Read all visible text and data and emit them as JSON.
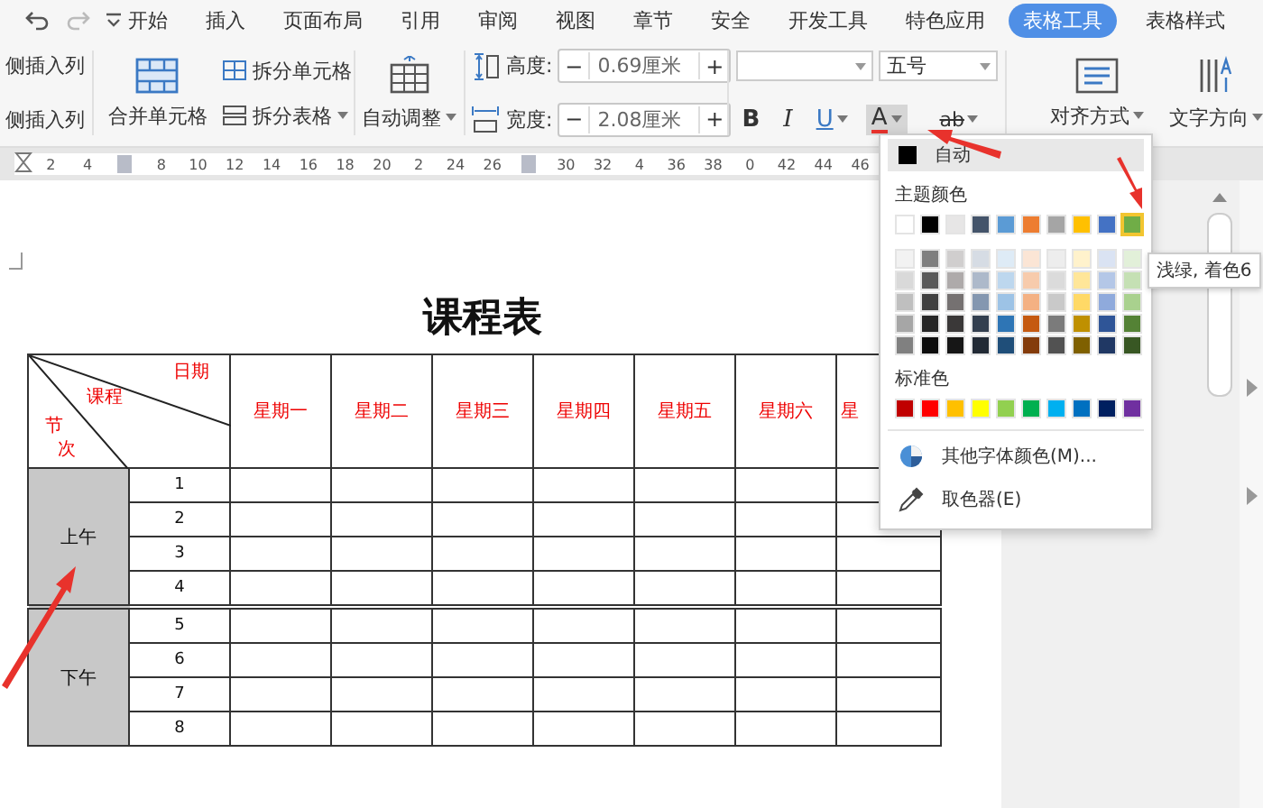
{
  "tabs": [
    {
      "label": "开始",
      "selected": false
    },
    {
      "label": "插入",
      "selected": false
    },
    {
      "label": "页面布局",
      "selected": false
    },
    {
      "label": "引用",
      "selected": false
    },
    {
      "label": "审阅",
      "selected": false
    },
    {
      "label": "视图",
      "selected": false
    },
    {
      "label": "章节",
      "selected": false
    },
    {
      "label": "安全",
      "selected": false
    },
    {
      "label": "开发工具",
      "selected": false
    },
    {
      "label": "特色应用",
      "selected": false
    },
    {
      "label": "表格工具",
      "selected": true
    },
    {
      "label": "表格样式",
      "selected": false
    }
  ],
  "ribbon": {
    "insert_columns": [
      "侧插入列",
      "侧插入列"
    ],
    "merge_cells": "合并单元格",
    "split_cells": "拆分单元格",
    "split_table": "拆分表格",
    "auto_fit": "自动调整",
    "sizes": [
      {
        "kind": "height",
        "label": "高度:",
        "decrement": "−",
        "value": "0.69厘米",
        "increment": "+"
      },
      {
        "kind": "width",
        "label": "宽度:",
        "decrement": "−",
        "value": "2.08厘米",
        "increment": "+"
      }
    ],
    "font_size": "五号",
    "format_buttons": [
      {
        "kind": "bold",
        "label": "B",
        "dropdown": false,
        "active": false
      },
      {
        "kind": "italic",
        "label": "I",
        "dropdown": false,
        "active": false
      },
      {
        "kind": "underline",
        "label": "U",
        "dropdown": true,
        "active": false
      },
      {
        "kind": "font_color",
        "label": "A",
        "dropdown": true,
        "active": true
      },
      {
        "kind": "highlight",
        "label": "ab",
        "dropdown": true,
        "active": false
      }
    ],
    "align": "对齐方式",
    "text_direction": "文字方向"
  },
  "ruler": {
    "ticks": [
      {
        "kind": "number",
        "label": "2"
      },
      {
        "kind": "number",
        "label": "4"
      },
      {
        "kind": "marker"
      },
      {
        "kind": "number",
        "label": "8"
      },
      {
        "kind": "number",
        "label": "10"
      },
      {
        "kind": "number",
        "label": "12"
      },
      {
        "kind": "number",
        "label": "14"
      },
      {
        "kind": "number",
        "label": "16"
      },
      {
        "kind": "number",
        "label": "18"
      },
      {
        "kind": "number",
        "label": "20"
      },
      {
        "kind": "number",
        "label": "2"
      },
      {
        "kind": "number",
        "label": "24"
      },
      {
        "kind": "number",
        "label": "26"
      },
      {
        "kind": "marker"
      },
      {
        "kind": "number",
        "label": "30"
      },
      {
        "kind": "number",
        "label": "32"
      },
      {
        "kind": "number",
        "label": "4"
      },
      {
        "kind": "number",
        "label": "36"
      },
      {
        "kind": "number",
        "label": "38"
      },
      {
        "kind": "number",
        "label": "0"
      },
      {
        "kind": "number",
        "label": "42"
      },
      {
        "kind": "number",
        "label": "44"
      },
      {
        "kind": "number",
        "label": "46"
      }
    ]
  },
  "document": {
    "title": "课程表",
    "corner": {
      "date": "日期",
      "course": "课程",
      "section": [
        "节",
        "次"
      ]
    },
    "days": [
      "星期一",
      "星期二",
      "星期三",
      "星期四",
      "星期五",
      "星期六",
      "星"
    ],
    "periods": [
      {
        "label": "上午",
        "rows": [
          "1",
          "2",
          "3",
          "4"
        ]
      },
      {
        "label": "下午",
        "rows": [
          "5",
          "6",
          "7",
          "8"
        ]
      }
    ]
  },
  "color_menu": {
    "auto": "自动",
    "theme_heading": "主题颜色",
    "theme": [
      {
        "color": "#ffffff",
        "selected": false
      },
      {
        "color": "#000000",
        "selected": false
      },
      {
        "color": "#e7e6e6",
        "selected": false
      },
      {
        "color": "#44546a",
        "selected": false
      },
      {
        "color": "#5b9bd5",
        "selected": false
      },
      {
        "color": "#ed7d31",
        "selected": false
      },
      {
        "color": "#a5a5a5",
        "selected": false
      },
      {
        "color": "#ffc000",
        "selected": false
      },
      {
        "color": "#4472c4",
        "selected": false
      },
      {
        "color": "#70ad47",
        "selected": true
      }
    ],
    "shades": [
      {
        "swatches": [
          {
            "color": "#f2f2f2"
          },
          {
            "color": "#7f7f7f"
          },
          {
            "color": "#d0cece"
          },
          {
            "color": "#d6dce4"
          },
          {
            "color": "#deebf6"
          },
          {
            "color": "#fbe5d5"
          },
          {
            "color": "#ededed"
          },
          {
            "color": "#fff2cc"
          },
          {
            "color": "#dae3f3"
          },
          {
            "color": "#e2f0d9"
          }
        ]
      },
      {
        "swatches": [
          {
            "color": "#d9d9d9"
          },
          {
            "color": "#595959"
          },
          {
            "color": "#aeaaaa"
          },
          {
            "color": "#adb9ca"
          },
          {
            "color": "#bdd7ee"
          },
          {
            "color": "#f7cbac"
          },
          {
            "color": "#dbdbdb"
          },
          {
            "color": "#ffe699"
          },
          {
            "color": "#b4c7e7"
          },
          {
            "color": "#c5e0b4"
          }
        ]
      },
      {
        "swatches": [
          {
            "color": "#bfbfbf"
          },
          {
            "color": "#404040"
          },
          {
            "color": "#757171"
          },
          {
            "color": "#8497b0"
          },
          {
            "color": "#9dc3e6"
          },
          {
            "color": "#f4b183"
          },
          {
            "color": "#c9c9c9"
          },
          {
            "color": "#ffd966"
          },
          {
            "color": "#8faadc"
          },
          {
            "color": "#a9d18e"
          }
        ]
      },
      {
        "swatches": [
          {
            "color": "#a6a6a6"
          },
          {
            "color": "#262626"
          },
          {
            "color": "#3a3838"
          },
          {
            "color": "#333f4f"
          },
          {
            "color": "#2e75b5"
          },
          {
            "color": "#c55a11"
          },
          {
            "color": "#7b7b7b"
          },
          {
            "color": "#bf9000"
          },
          {
            "color": "#2f5597"
          },
          {
            "color": "#548235"
          }
        ]
      },
      {
        "swatches": [
          {
            "color": "#808080"
          },
          {
            "color": "#0d0d0d"
          },
          {
            "color": "#161616"
          },
          {
            "color": "#222a35"
          },
          {
            "color": "#1f4e79"
          },
          {
            "color": "#843c0b"
          },
          {
            "color": "#525252"
          },
          {
            "color": "#7f6000"
          },
          {
            "color": "#203864"
          },
          {
            "color": "#385723"
          }
        ]
      }
    ],
    "standard_heading": "标准色",
    "standard": [
      {
        "color": "#c00000"
      },
      {
        "color": "#ff0000"
      },
      {
        "color": "#ffc000"
      },
      {
        "color": "#ffff00"
      },
      {
        "color": "#92d050"
      },
      {
        "color": "#00b050"
      },
      {
        "color": "#00b0f0"
      },
      {
        "color": "#0070c0"
      },
      {
        "color": "#002060"
      },
      {
        "color": "#7030a0"
      }
    ],
    "more": "其他字体颜色(M)...",
    "picker": "取色器(E)",
    "tooltip": "浅绿, 着色6"
  }
}
